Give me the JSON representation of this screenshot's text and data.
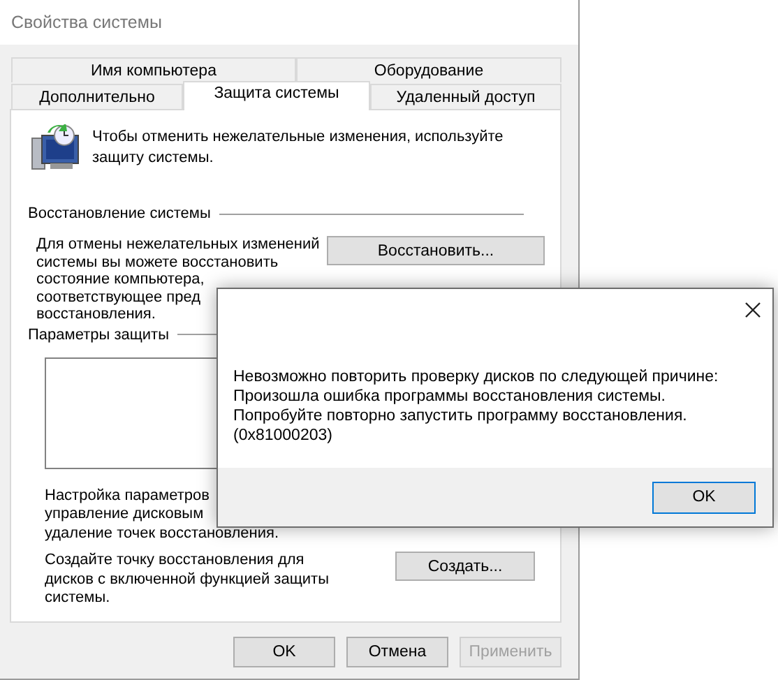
{
  "window": {
    "title": "Свойства системы"
  },
  "tabs_top": [
    {
      "label": "Имя компьютера",
      "selected": false
    },
    {
      "label": "Оборудование",
      "selected": false
    }
  ],
  "tabs_bottom": [
    {
      "label": "Дополнительно",
      "selected": false
    },
    {
      "label": "Защита системы",
      "selected": true
    },
    {
      "label": "Удаленный доступ",
      "selected": false
    }
  ],
  "intro": "Чтобы отменить нежелательные изменения, используйте защиту системы.",
  "restore_section": {
    "title": "Восстановление системы",
    "lines": [
      "Для отмены нежелательных изменений",
      "системы вы можете восстановить",
      "состояние компьютера,",
      "соответствующее пред",
      "восстановления."
    ],
    "button": "Восстановить..."
  },
  "protection_section": {
    "title": "Параметры защиты",
    "config_lines": [
      "Настройка параметров",
      "управление дисковым",
      "удаление точек восстановления."
    ],
    "create_text": "Создайте точку восстановления для дисков с включенной функцией защиты системы.",
    "create_button": "Создать..."
  },
  "buttons": [
    {
      "label": "OK",
      "disabled": false
    },
    {
      "label": "Отмена",
      "disabled": false
    },
    {
      "label": "Применить",
      "disabled": true
    }
  ],
  "dialog": {
    "message": [
      "Невозможно повторить проверку дисков по следующей причине:",
      "Произошла ошибка программы восстановления системы.",
      "Попробуйте повторно запустить программу восстановления.",
      "(0x81000203)"
    ],
    "button": "OK"
  }
}
